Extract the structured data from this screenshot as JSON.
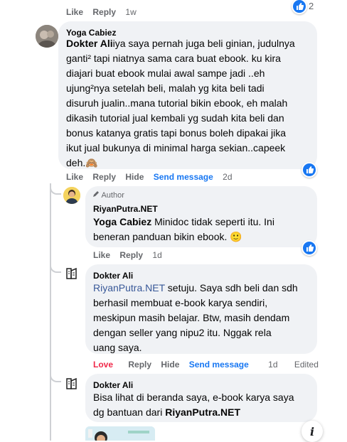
{
  "top_actions": {
    "like": "Like",
    "reply": "Reply",
    "time": "1w",
    "reaction_count": "2"
  },
  "c1": {
    "name": "Yoga Cabiez",
    "mention": "Dokter Ali",
    "lines": [
      "iya saya pernah juga beli ginian, judulnya",
      "ganti² tapi niatnya sama cara buat ebook. ku kira",
      "diajari buat ebook mulai awal sampe jadi ..eh",
      "ujung²nya setelah beli, malah yg kita beli tadi",
      "disuruh jualin..mana tutorial bikin ebook, eh malah",
      "dikasih tutorial jual kembali yg sudah kita beli dan",
      "bonus katanya gratis tapi bonus boleh dipakai jika",
      "ikut jual bukunya di minimal harga sekian..capeek",
      "deh.🙈"
    ],
    "actions": {
      "like": "Like",
      "reply": "Reply",
      "hide": "Hide",
      "send": "Send message",
      "time": "2d"
    }
  },
  "c2": {
    "badge": "Author",
    "name": "RiyanPutra.NET",
    "mention": "Yoga Cabiez",
    "line1": " Minidoc tidak seperti itu. Ini",
    "line2": "beneran panduan bikin ebook. 🙂",
    "actions": {
      "like": "Like",
      "reply": "Reply",
      "time": "1d"
    }
  },
  "c3": {
    "name": "Dokter Ali",
    "mention": "RiyanPutra.NET",
    "line1": " setuju. Saya sdh beli dan sdh",
    "lines": [
      "berhasil membuat e-book karya sendiri,",
      "meskipun masih belajar. Btw, masih dendam",
      "dengan seller yang nipu2 itu. Nggak rela",
      "uang saya."
    ],
    "actions": {
      "love": "Love",
      "reply": "Reply",
      "hide": "Hide",
      "send": "Send message",
      "time": "1d",
      "edited": "Edited"
    }
  },
  "c4": {
    "name": "Dokter Ali",
    "line1": "Bisa lihat di beranda saya, e-book karya saya",
    "line2_prefix": "dg bantuan dari ",
    "line2_bold": "RiyanPutra.NET"
  },
  "info_icon": "i"
}
